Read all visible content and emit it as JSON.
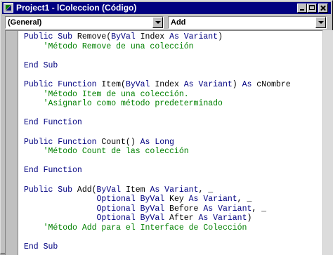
{
  "window": {
    "title": "Project1 - lColeccion (Código)"
  },
  "object_combo": {
    "value": "(General)"
  },
  "procedure_combo": {
    "value": "Add"
  },
  "code_lines": [
    [
      {
        "t": "Public Sub ",
        "c": "kw"
      },
      {
        "t": "Remove(",
        "c": "tx"
      },
      {
        "t": "ByVal",
        "c": "kw"
      },
      {
        "t": " Index ",
        "c": "tx"
      },
      {
        "t": "As Variant",
        "c": "kw"
      },
      {
        "t": ")",
        "c": "tx"
      }
    ],
    [
      {
        "t": "    'Método Remove de una colección",
        "c": "cm"
      }
    ],
    [],
    [
      {
        "t": "End Sub",
        "c": "kw"
      }
    ],
    [],
    [
      {
        "t": "Public Function ",
        "c": "kw"
      },
      {
        "t": "Item(",
        "c": "tx"
      },
      {
        "t": "ByVal",
        "c": "kw"
      },
      {
        "t": " Index ",
        "c": "tx"
      },
      {
        "t": "As Variant",
        "c": "kw"
      },
      {
        "t": ") ",
        "c": "tx"
      },
      {
        "t": "As",
        "c": "kw"
      },
      {
        "t": " cNombre",
        "c": "tx"
      }
    ],
    [
      {
        "t": "    'Método Item de una colección.",
        "c": "cm"
      }
    ],
    [
      {
        "t": "    'Asignarlo como método predeterminado",
        "c": "cm"
      }
    ],
    [],
    [
      {
        "t": "End Function",
        "c": "kw"
      }
    ],
    [],
    [
      {
        "t": "Public Function ",
        "c": "kw"
      },
      {
        "t": "Count() ",
        "c": "tx"
      },
      {
        "t": "As Long",
        "c": "kw"
      }
    ],
    [
      {
        "t": "    'Método Count de las colección",
        "c": "cm"
      }
    ],
    [],
    [
      {
        "t": "End Function",
        "c": "kw"
      }
    ],
    [],
    [
      {
        "t": "Public Sub ",
        "c": "kw"
      },
      {
        "t": "Add(",
        "c": "tx"
      },
      {
        "t": "ByVal",
        "c": "kw"
      },
      {
        "t": " Item ",
        "c": "tx"
      },
      {
        "t": "As Variant",
        "c": "kw"
      },
      {
        "t": ", _",
        "c": "tx"
      }
    ],
    [
      {
        "t": "               Optional ByVal",
        "c": "kw"
      },
      {
        "t": " Key ",
        "c": "tx"
      },
      {
        "t": "As Variant",
        "c": "kw"
      },
      {
        "t": ", _",
        "c": "tx"
      }
    ],
    [
      {
        "t": "               Optional ByVal",
        "c": "kw"
      },
      {
        "t": " Before ",
        "c": "tx"
      },
      {
        "t": "As Variant",
        "c": "kw"
      },
      {
        "t": ", _",
        "c": "tx"
      }
    ],
    [
      {
        "t": "               Optional ByVal",
        "c": "kw"
      },
      {
        "t": " After ",
        "c": "tx"
      },
      {
        "t": "As Variant",
        "c": "kw"
      },
      {
        "t": ")",
        "c": "tx"
      }
    ],
    [
      {
        "t": "    'Método Add para el Interface de Colección",
        "c": "cm"
      }
    ],
    [],
    [
      {
        "t": "End Sub",
        "c": "kw"
      }
    ]
  ]
}
